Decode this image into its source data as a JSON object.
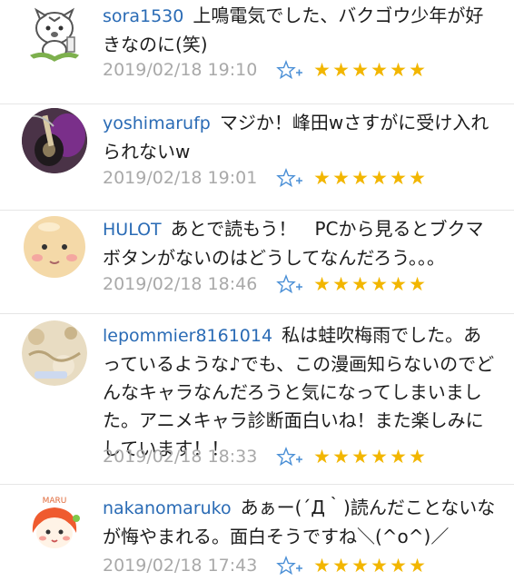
{
  "comments": [
    {
      "user": "sora1530",
      "text": "上鳴電気でした、バクゴウ少年が好きなのに(笑)",
      "date": "2019/02/18 19:10",
      "stars": [
        "★",
        "★",
        "★",
        "★",
        "★",
        "★"
      ],
      "avatar_icon": "white-tiger-cartoon-avatar"
    },
    {
      "user": "yoshimarufp",
      "text": "マジか！峰田wさすがに受け入れられないw",
      "date": "2019/02/18 19:01",
      "stars": [
        "★",
        "★",
        "★",
        "★",
        "★",
        "★"
      ],
      "avatar_icon": "guitar-photo-avatar"
    },
    {
      "user": "HULOT",
      "text": "あとで読もう！　PCから見るとブクマボタンがないのはどうしてなんだろう。。。",
      "date": "2019/02/18 18:46",
      "stars": [
        "★",
        "★",
        "★",
        "★",
        "★",
        "★"
      ],
      "avatar_icon": "bald-face-avatar"
    },
    {
      "user": "lepommier8161014",
      "text": "私は蛙吹梅雨でした。あっているような♪でも、この漫画知らないのでどんなキャラなんだろうと気になってしまいました。アニメキャラ診断面白いね！また楽しみにしています！！",
      "date": "2019/02/18 18:33",
      "stars": [
        "★",
        "★",
        "★",
        "★",
        "★",
        "★"
      ],
      "avatar_icon": "beige-pattern-avatar"
    },
    {
      "user": "nakanomaruko",
      "text": "あぁー(´Д｀)読んだことないなが悔やまれる。面白そうですね＼(^o^)／",
      "date": "2019/02/18 17:43",
      "stars": [
        "★",
        "★",
        "★",
        "★",
        "★",
        "★"
      ],
      "avatar_icon": "maru-girl-avatar",
      "avatar_text": "MARU"
    }
  ],
  "icons": {
    "add_star": "add-star-icon",
    "star": "star-icon"
  },
  "colors": {
    "username": "#2a6bb5",
    "date": "#a9a9a9",
    "star": "#f2b600",
    "add_star": "#4a8fd6"
  }
}
